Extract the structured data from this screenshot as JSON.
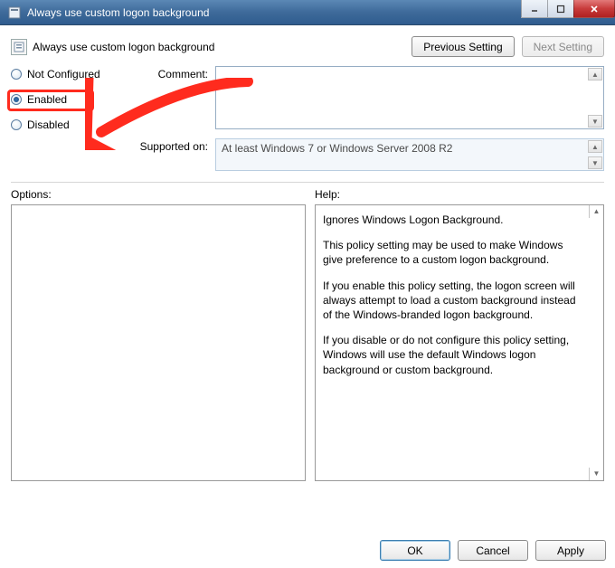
{
  "titlebar": {
    "title": "Always use custom logon background"
  },
  "header": {
    "policy_name": "Always use custom logon background",
    "prev_label": "Previous Setting",
    "next_label": "Next Setting"
  },
  "radios": {
    "not_configured": "Not Configured",
    "enabled": "Enabled",
    "disabled": "Disabled",
    "selected": "enabled"
  },
  "fields": {
    "comment_label": "Comment:",
    "comment_value": "",
    "supported_label": "Supported on:",
    "supported_value": "At least Windows 7 or Windows Server 2008 R2"
  },
  "panels": {
    "options_label": "Options:",
    "help_label": "Help:"
  },
  "help": {
    "p1": "Ignores Windows Logon Background.",
    "p2": "This policy setting may be used to make Windows give preference to a custom logon background.",
    "p3": "If you enable this policy setting, the logon screen will always attempt to load a custom background instead of the Windows-branded logon background.",
    "p4": "If you disable or do not configure this policy setting, Windows will use the default Windows logon background or custom background."
  },
  "footer": {
    "ok": "OK",
    "cancel": "Cancel",
    "apply": "Apply"
  }
}
